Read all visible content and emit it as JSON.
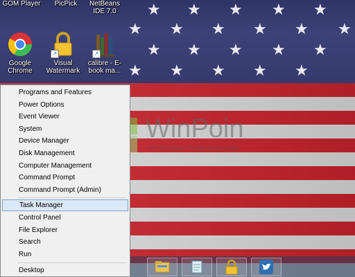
{
  "desktop": {
    "top_labels": [
      "GOM Player",
      "PicPick",
      "NetBeans IDE 7.0"
    ],
    "icons": [
      {
        "label": "Google Chrome",
        "icon": "chrome-icon"
      },
      {
        "label": "Visual Watermark",
        "icon": "lock-icon"
      },
      {
        "label": "calibre - E-book ma...",
        "icon": "books-icon"
      }
    ],
    "watermark": {
      "brand": "WinPoin",
      "tagline": "#1 Windows Portal Indonesia"
    }
  },
  "context_menu": {
    "items": [
      {
        "label": "Programs and Features"
      },
      {
        "label": "Power Options"
      },
      {
        "label": "Event Viewer"
      },
      {
        "label": "System"
      },
      {
        "label": "Device Manager"
      },
      {
        "label": "Disk Management"
      },
      {
        "label": "Computer Management"
      },
      {
        "label": "Command Prompt"
      },
      {
        "label": "Command Prompt (Admin)"
      },
      {
        "label": "Task Manager",
        "selected": true
      },
      {
        "label": "Control Panel"
      },
      {
        "label": "File Explorer"
      },
      {
        "label": "Search"
      },
      {
        "label": "Run"
      },
      {
        "label": "Desktop"
      }
    ]
  },
  "taskbar": {
    "buttons": [
      "file-explorer-icon",
      "notepad-icon",
      "visual-watermark-icon",
      "twitter-icon"
    ]
  },
  "colors": {
    "accent": "#7da2ce",
    "selection": "#dce8f6",
    "stripe_red": "#c8232c",
    "canton_blue": "#3a3f72"
  }
}
